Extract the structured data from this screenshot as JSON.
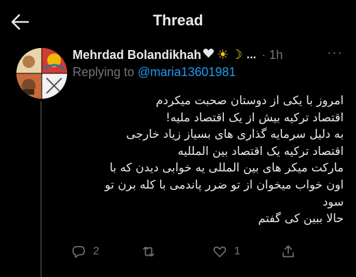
{
  "header": {
    "title": "Thread"
  },
  "tweet": {
    "author_name": "Mehrdad Bolandikhah",
    "name_suffix": "...",
    "time": "· 1h",
    "more_label": "···",
    "replying_prefix": "Replying to ",
    "replying_handle": "@maria13601981",
    "body_lines": [
      "امروز با یکی از دوستان صحبت میکردم",
      "اقتصاد ترکیه بیش از یک اقتصاد ملیه!",
      "به دلیل سرمایه گذاری های بسیاز زیاد خارجی",
      "اقتصاد ترکیه یک اقتصاد بین المللیه",
      "مارکت میکر های بین المللی یه خوابی دیدن که با",
      "اون خواب میخوان از تو ضرر پاندمی با کله برن تو",
      "سود",
      "حالا ببین کی گفتم"
    ],
    "actions": {
      "reply_count": "2",
      "retweet_count": "",
      "like_count": "1"
    }
  },
  "icons": {
    "back": "back-arrow-icon",
    "reply": "reply-icon",
    "retweet": "retweet-icon",
    "like": "heart-icon",
    "share": "share-icon"
  },
  "colors": {
    "background": "#000000",
    "text": "#e7e9ea",
    "muted": "#71767b",
    "link": "#1d9bf0",
    "emoji_yellow": "#f5c518"
  }
}
